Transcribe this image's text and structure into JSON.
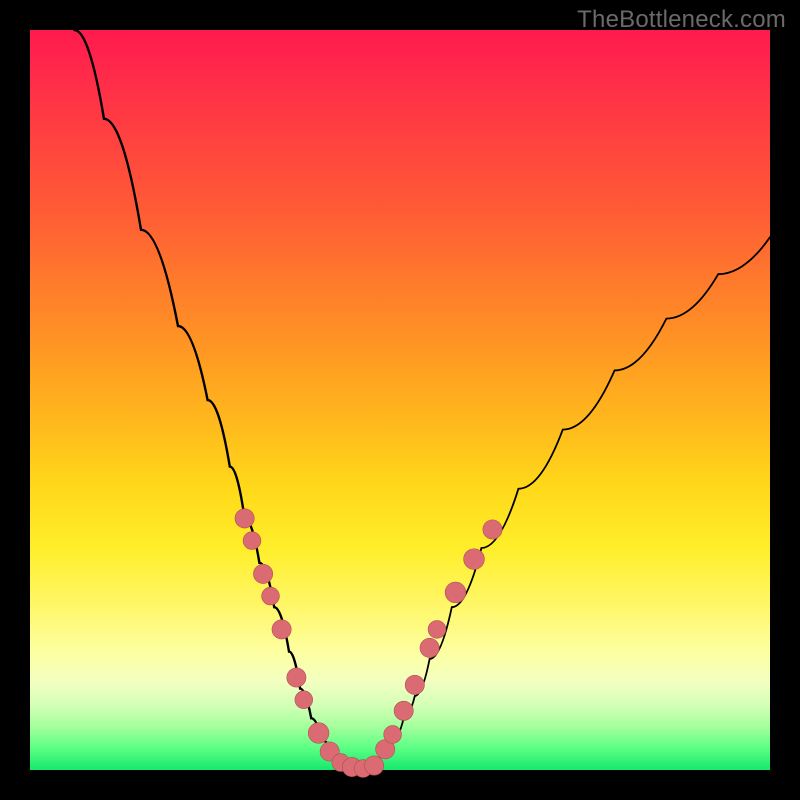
{
  "watermark": "TheBottleneck.com",
  "colors": {
    "background": "#000000",
    "gradient_top": "#ff1a4d",
    "gradient_mid": "#ffd91a",
    "gradient_bottom": "#15e96e",
    "curve": "#000000",
    "marker_fill": "#db6b72",
    "marker_stroke": "#b34c54"
  },
  "chart_data": {
    "type": "line",
    "title": "",
    "xlabel": "",
    "ylabel": "",
    "xlim": [
      0,
      100
    ],
    "ylim": [
      0,
      100
    ],
    "grid": false,
    "legend": null,
    "series": [
      {
        "name": "left-branch",
        "x": [
          6,
          10,
          15,
          20,
          24,
          27,
          29,
          31,
          33,
          35,
          36.5,
          38,
          39.5,
          41,
          43,
          44
        ],
        "y": [
          100,
          88,
          73,
          60,
          50,
          41,
          34,
          28,
          22,
          16,
          11,
          7,
          4,
          2,
          0.5,
          0
        ]
      },
      {
        "name": "right-branch",
        "x": [
          44,
          46,
          47.5,
          49,
          50.5,
          52,
          54,
          57,
          61,
          66,
          72,
          79,
          86,
          93,
          100
        ],
        "y": [
          0,
          0.5,
          2,
          4,
          7,
          10,
          15,
          22,
          30,
          38,
          46,
          54,
          61,
          67,
          72
        ]
      }
    ],
    "markers": [
      {
        "branch": "left",
        "x": 29.0,
        "y": 34.0,
        "r": 1.3
      },
      {
        "branch": "left",
        "x": 30.0,
        "y": 31.0,
        "r": 1.2
      },
      {
        "branch": "left",
        "x": 31.5,
        "y": 26.5,
        "r": 1.3
      },
      {
        "branch": "left",
        "x": 32.5,
        "y": 23.5,
        "r": 1.2
      },
      {
        "branch": "left",
        "x": 34.0,
        "y": 19.0,
        "r": 1.3
      },
      {
        "branch": "left",
        "x": 36.0,
        "y": 12.5,
        "r": 1.3
      },
      {
        "branch": "left",
        "x": 37.0,
        "y": 9.5,
        "r": 1.2
      },
      {
        "branch": "left",
        "x": 39.0,
        "y": 5.0,
        "r": 1.4
      },
      {
        "branch": "left",
        "x": 40.5,
        "y": 2.5,
        "r": 1.3
      },
      {
        "branch": "left",
        "x": 42.0,
        "y": 1.0,
        "r": 1.2
      },
      {
        "branch": "left",
        "x": 43.5,
        "y": 0.4,
        "r": 1.3
      },
      {
        "branch": "left",
        "x": 45.0,
        "y": 0.2,
        "r": 1.2
      },
      {
        "branch": "right",
        "x": 46.5,
        "y": 0.6,
        "r": 1.3
      },
      {
        "branch": "right",
        "x": 48.0,
        "y": 2.8,
        "r": 1.3
      },
      {
        "branch": "right",
        "x": 49.0,
        "y": 4.8,
        "r": 1.2
      },
      {
        "branch": "right",
        "x": 50.5,
        "y": 8.0,
        "r": 1.3
      },
      {
        "branch": "right",
        "x": 52.0,
        "y": 11.5,
        "r": 1.3
      },
      {
        "branch": "right",
        "x": 54.0,
        "y": 16.5,
        "r": 1.3
      },
      {
        "branch": "right",
        "x": 55.0,
        "y": 19.0,
        "r": 1.2
      },
      {
        "branch": "right",
        "x": 57.5,
        "y": 24.0,
        "r": 1.4
      },
      {
        "branch": "right",
        "x": 60.0,
        "y": 28.5,
        "r": 1.4
      },
      {
        "branch": "right",
        "x": 62.5,
        "y": 32.5,
        "r": 1.3
      }
    ]
  }
}
